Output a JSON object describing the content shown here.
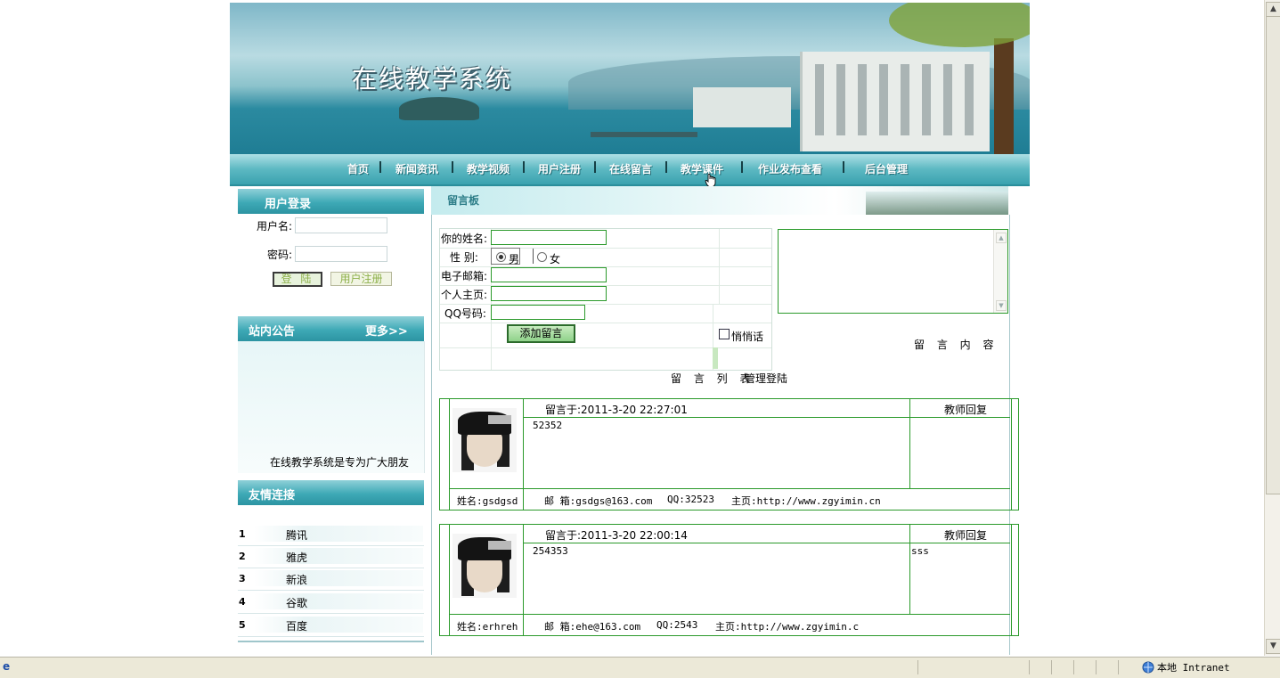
{
  "site": {
    "title": "在线教学系统"
  },
  "nav": {
    "items": [
      "首页",
      "新闻资讯",
      "教学视频",
      "用户注册",
      "在线留言",
      "教学课件",
      "作业发布查看",
      "后台管理"
    ]
  },
  "login": {
    "title": "用户登录",
    "username_label": "用户名:",
    "password_label": "密码:",
    "login_button": "登 陆",
    "register_button": "用户注册"
  },
  "notice": {
    "title": "站内公告",
    "more": "更多>>",
    "text": "在线教学系统是专为广大朋友"
  },
  "links": {
    "title": "友情连接",
    "items": [
      {
        "num": "1",
        "name": "腾讯"
      },
      {
        "num": "2",
        "name": "雅虎"
      },
      {
        "num": "3",
        "name": "新浪"
      },
      {
        "num": "4",
        "name": "谷歌"
      },
      {
        "num": "5",
        "name": "百度"
      }
    ]
  },
  "guestbook": {
    "title": "留言板",
    "form": {
      "name_label": "你的姓名:",
      "gender_label": "性 别:",
      "gender_male": "男",
      "gender_female": "女",
      "email_label": "电子邮箱:",
      "homepage_label": "个人主页:",
      "qq_label": "QQ号码:",
      "submit": "添加留言",
      "whisper": "悄悄话"
    },
    "content_caption": "留 言 内 容",
    "list_link": "留 言 列 表",
    "admin_link": "管理登陆"
  },
  "messages": [
    {
      "time": "留言于:2011-3-20 22:27:01",
      "reply_header": "教师回复",
      "content": "52352",
      "reply": "",
      "name": "姓名:gsdgsd",
      "email": "邮 箱:gsdgs@163.com",
      "qq": "QQ:32523",
      "homepage": "主页:http://www.zgyimin.cn"
    },
    {
      "time": "留言于:2011-3-20 22:00:14",
      "reply_header": "教师回复",
      "content": "254353",
      "reply": "sss",
      "name": "姓名:erhreh",
      "email": "邮 箱:ehe@163.com",
      "qq": "QQ:2543",
      "homepage": "主页:http://www.zgyimin.c"
    }
  ],
  "statusbar": {
    "zone": "本地 Intranet"
  }
}
